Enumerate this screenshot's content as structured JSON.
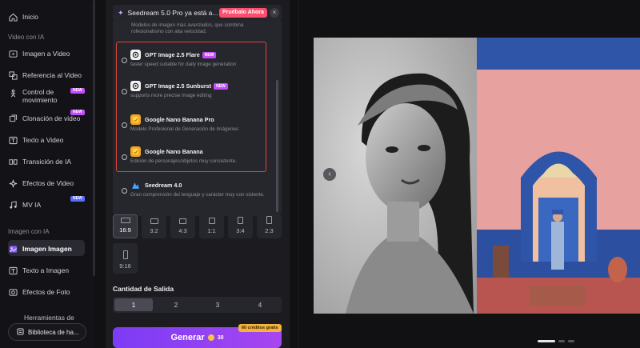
{
  "sidebar": {
    "items_top": [
      {
        "label": "Inicio",
        "icon": "home-icon"
      }
    ],
    "section_video": "Video con IA",
    "video_items": [
      {
        "label": "Imagen a Video",
        "icon": "image-video-icon"
      },
      {
        "label": "Referencia al Video",
        "icon": "reference-icon"
      },
      {
        "label": "Control de movimiento",
        "icon": "motion-icon"
      },
      {
        "label": "Clonación de video",
        "icon": "clone-icon"
      },
      {
        "label": "Texto a Video",
        "icon": "text-video-icon"
      },
      {
        "label": "Transición de IA",
        "icon": "transition-icon"
      },
      {
        "label": "Efectos de Video",
        "icon": "effects-icon"
      },
      {
        "label": "MV IA",
        "icon": "music-icon"
      }
    ],
    "section_image": "Imagen con IA",
    "image_items": [
      {
        "label": "Imagen Imagen",
        "icon": "image-icon"
      },
      {
        "label": "Texto a Imagen",
        "icon": "text-image-icon"
      },
      {
        "label": "Efectos de Foto",
        "icon": "photo-effects-icon"
      }
    ],
    "tools_label": "Herramientas de",
    "library_label": "Biblioteca de ha...",
    "accent": "#c54bff"
  },
  "notification": {
    "text": "Seedream 5.0 Pro ya está a...",
    "cta": "Pruébalo Ahora",
    "close": "×"
  },
  "dropdown": {
    "top_desc": "Modelos de imagen más avanzados, que combina rofesionalismo con alta velocidad.",
    "models": [
      {
        "name": "GPT Image 2.5 Flare",
        "badge": "NEW",
        "desc": "faster speed suitable for daily image generation"
      },
      {
        "name": "GPT Image 2.5 Sunburst",
        "badge": "NEW",
        "desc": "supports more precise image editing"
      },
      {
        "name": "Google Nano Banana Pro",
        "badge": "",
        "desc": "Modelo Profesional de Generación de Imágenes"
      },
      {
        "name": "Google Nano Banana",
        "badge": "",
        "desc": "Edición de personajes/objetos muy consistente."
      },
      {
        "name": "Seedream 4.0",
        "badge": "",
        "desc": "Gran comprensión del lenguaje y carácter muy con sistente."
      }
    ]
  },
  "ratios": [
    "16:9",
    "3:2",
    "4:3",
    "1:1",
    "3:4",
    "2:3",
    "9:16"
  ],
  "output": {
    "label": "Cantidad de Salida",
    "options": [
      "1",
      "2",
      "3",
      "4"
    ],
    "selected": "1"
  },
  "generate": {
    "label": "Generar",
    "cost": "30",
    "free_badge": "60 créditos gratis"
  },
  "preview": {
    "prev": "‹"
  }
}
